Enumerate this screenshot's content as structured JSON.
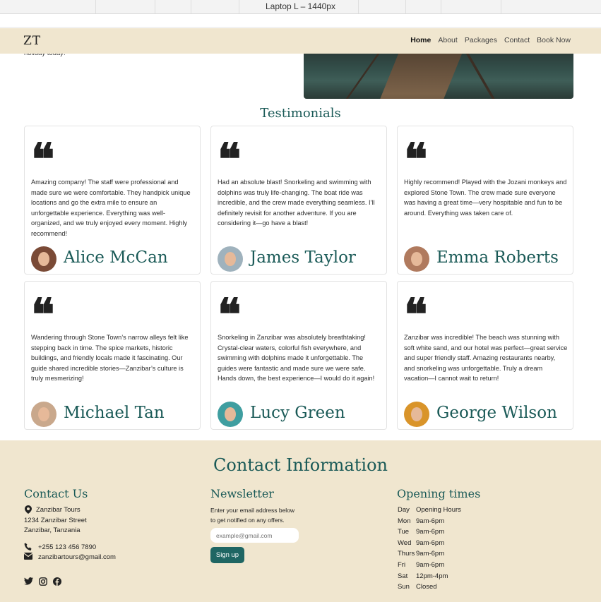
{
  "devtools": {
    "viewport_label": "Laptop L – 1440px"
  },
  "navbar": {
    "logo": "ZT",
    "links": [
      "Home",
      "About",
      "Packages",
      "Contact",
      "Book Now"
    ]
  },
  "hero": {
    "text_fragment": "holiday today!"
  },
  "testimonials": {
    "title": "Testimonials",
    "quote_glyph": "❝",
    "cards": [
      {
        "name": "Alice McCan",
        "text": "Amazing company! The staff were professional and made sure we were comfortable. They handpick unique locations and go the extra mile to ensure an unforgettable experience. Everything was well-organized, and we truly enjoyed every moment. Highly recommend!",
        "avatar_color": "#7a4a36"
      },
      {
        "name": "James Taylor",
        "text": "Had an absolute blast! Snorkeling and swimming with dolphins was truly life-changing. The boat ride was incredible, and the crew made everything seamless. I’ll definitely revisit for another adventure. If you are considering it—go have a blast!",
        "avatar_color": "#9fb2bd"
      },
      {
        "name": "Emma Roberts",
        "text": "Highly recommend! Played with the Jozani monkeys and explored Stone Town. The crew made sure everyone was having a great time—very hospitable and fun to be around. Everything was taken care of.",
        "avatar_color": "#b07a5e"
      },
      {
        "name": "Michael Tan",
        "text": "Wandering through Stone Town’s narrow alleys felt like stepping back in time. The spice markets, historic buildings, and friendly locals made it fascinating. Our guide shared incredible stories—Zanzibar’s culture is truly mesmerizing!",
        "avatar_color": "#c9a88c"
      },
      {
        "name": "Lucy Green",
        "text": "Snorkeling in Zanzibar was absolutely breathtaking! Crystal-clear waters, colorful fish everywhere, and swimming with dolphins made it unforgettable. The guides were fantastic and made sure we were safe. Hands down, the best experience—I would do it again!",
        "avatar_color": "#3f9ea0"
      },
      {
        "name": "George Wilson",
        "text": "Zanzibar was incredible! The beach was stunning with soft white sand, and our hotel was perfect—great service and super friendly staff. Amazing restaurants nearby, and snorkeling was unforgettable. Truly a dream vacation—I cannot wait to return!",
        "avatar_color": "#d9942a"
      }
    ]
  },
  "footer": {
    "title": "Contact Information",
    "contact": {
      "heading": "Contact Us",
      "company": "Zanzibar Tours",
      "street": "1234 Zanzibar Street",
      "city": "Zanzibar, Tanzania",
      "phone": "+255 123 456 7890",
      "email": "zanzibartours@gmail.com",
      "social_icons": [
        "twitter-icon",
        "instagram-icon",
        "facebook-icon"
      ]
    },
    "newsletter": {
      "heading": "Newsletter",
      "line1": "Enter your email address below",
      "line2": "to get notified on any offers.",
      "placeholder": "example@gmail.com",
      "button": "Sign up"
    },
    "hours": {
      "heading": "Opening times",
      "rows": [
        {
          "day": "Day",
          "time": "Opening Hours"
        },
        {
          "day": "Mon",
          "time": "9am-6pm"
        },
        {
          "day": "Tue",
          "time": "9am-6pm"
        },
        {
          "day": "Wed",
          "time": "9am-6pm"
        },
        {
          "day": "Thurs",
          "time": "9am-6pm"
        },
        {
          "day": "Fri",
          "time": "9am-6pm"
        },
        {
          "day": "Sat",
          "time": "12pm-4pm"
        },
        {
          "day": "Sun",
          "time": "Closed"
        }
      ]
    }
  },
  "colors": {
    "accent": "#1a5a57",
    "beige": "#f0e6cf",
    "button": "#1f6663"
  }
}
